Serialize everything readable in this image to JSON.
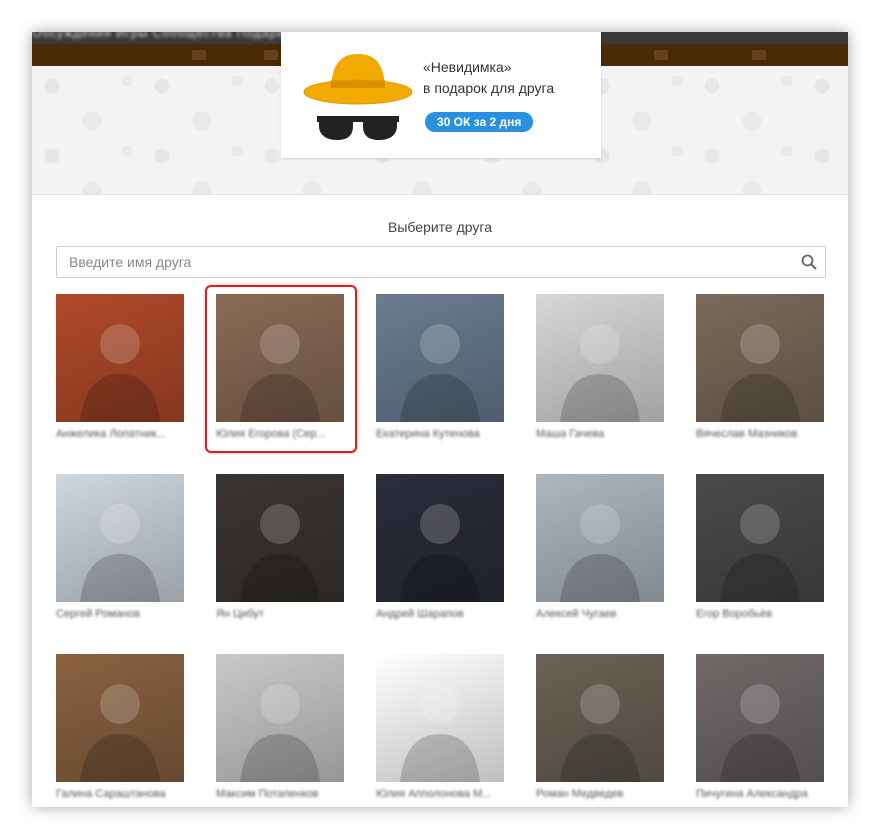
{
  "gift": {
    "name": "«Невидимка»",
    "subtitle": "в подарок для друга",
    "price_label": "30 ОК за 2 дня",
    "icon": "invisible-hat-glasses-icon"
  },
  "site_menu": "Обсуждения   Игры   Сообщества   Подарки",
  "choose_title": "Выберите друга",
  "search": {
    "placeholder": "Введите имя друга",
    "value": "",
    "icon": "search-icon"
  },
  "friends": [
    {
      "name": "Анжелика Лопатник...",
      "selected": false,
      "bg": "#b04a2a"
    },
    {
      "name": "Юлия Егорова (Сер...",
      "selected": true,
      "bg": "#8a6a55"
    },
    {
      "name": "Екатерина Кутенова",
      "selected": false,
      "bg": "#6a7c92"
    },
    {
      "name": "Маша Гачева",
      "selected": false,
      "bg": "#d7d7d7"
    },
    {
      "name": "Вячеслав Мазников",
      "selected": false,
      "bg": "#7a6a5a"
    },
    {
      "name": "Сергей Романов",
      "selected": false,
      "bg": "#cfd6df"
    },
    {
      "name": "Ян Цибут",
      "selected": false,
      "bg": "#3a3532"
    },
    {
      "name": "Андрей Шарапов",
      "selected": false,
      "bg": "#2a2d3a"
    },
    {
      "name": "Алексей Чугаев",
      "selected": false,
      "bg": "#aeb6c0"
    },
    {
      "name": "Егор Воробьёв",
      "selected": false,
      "bg": "#4a4a4a"
    },
    {
      "name": "Галина Сараштанова",
      "selected": false,
      "bg": "#8a6240"
    },
    {
      "name": "Максим Потапенков",
      "selected": false,
      "bg": "#c7c9cb"
    },
    {
      "name": "Юлия Апполонова М...",
      "selected": false,
      "bg": "#ffffff"
    },
    {
      "name": "Роман Медведев",
      "selected": false,
      "bg": "#6a6256"
    },
    {
      "name": "Пичугина Александра",
      "selected": false,
      "bg": "#6f6a68"
    }
  ],
  "colors": {
    "accent": "#2a90e0",
    "selection": "#d61f1f",
    "hat": "#f2a900"
  }
}
